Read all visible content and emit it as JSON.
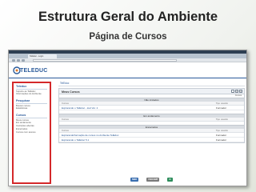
{
  "slide": {
    "title": "Estrutura Geral do Ambiente",
    "subtitle": "Página de Cursos"
  },
  "browser": {
    "tab_label": "TelEduc - Login"
  },
  "app": {
    "logo_text": "TELEDUC"
  },
  "sidebar": {
    "sections": [
      {
        "heading": "Teleduc",
        "items": [
          "Suporte ao TelEduc",
          "Informações do Ambiente"
        ]
      },
      {
        "heading": "Pesquisar",
        "items": [
          "Buscar cursos",
          "Estatísticas"
        ]
      },
      {
        "heading": "Cursos",
        "items": [
          "Meus cursos",
          "Em andamento",
          "Inscrições abertas",
          "Encerrados",
          "Cursos com acesso"
        ]
      }
    ]
  },
  "content": {
    "breadcrumb": "TelEduc",
    "panel_title": "Meus Cursos",
    "panel_controls": [
      "_",
      "□",
      "x"
    ],
    "under_note": "Cursos",
    "sections": [
      {
        "heading": "Não iniciados",
        "col_left": "Cursos",
        "col_right": "Tipo usuário",
        "rows": [
          {
            "name": "Explorando o TelEduc - 2ed Ver. 2",
            "status": "Formador"
          }
        ]
      },
      {
        "heading": "Em andamento",
        "col_left": "Cursos",
        "col_right": "Tipo usuário",
        "rows": []
      },
      {
        "heading": "Encerrados",
        "col_left": "Cursos",
        "col_right": "Tipo usuário",
        "rows": [
          {
            "name": "Explorando/formação de cursos no Ambiente TelEduc",
            "status": "Formador"
          },
          {
            "name": "Explorando o TelEduc 5.1",
            "status": "Formador"
          }
        ]
      }
    ]
  },
  "footer_logos": [
    "NIED",
    "UNICAMP",
    "IC"
  ],
  "colors": {
    "highlight_border": "#d4282a",
    "brand_blue": "#2a5a9a"
  }
}
